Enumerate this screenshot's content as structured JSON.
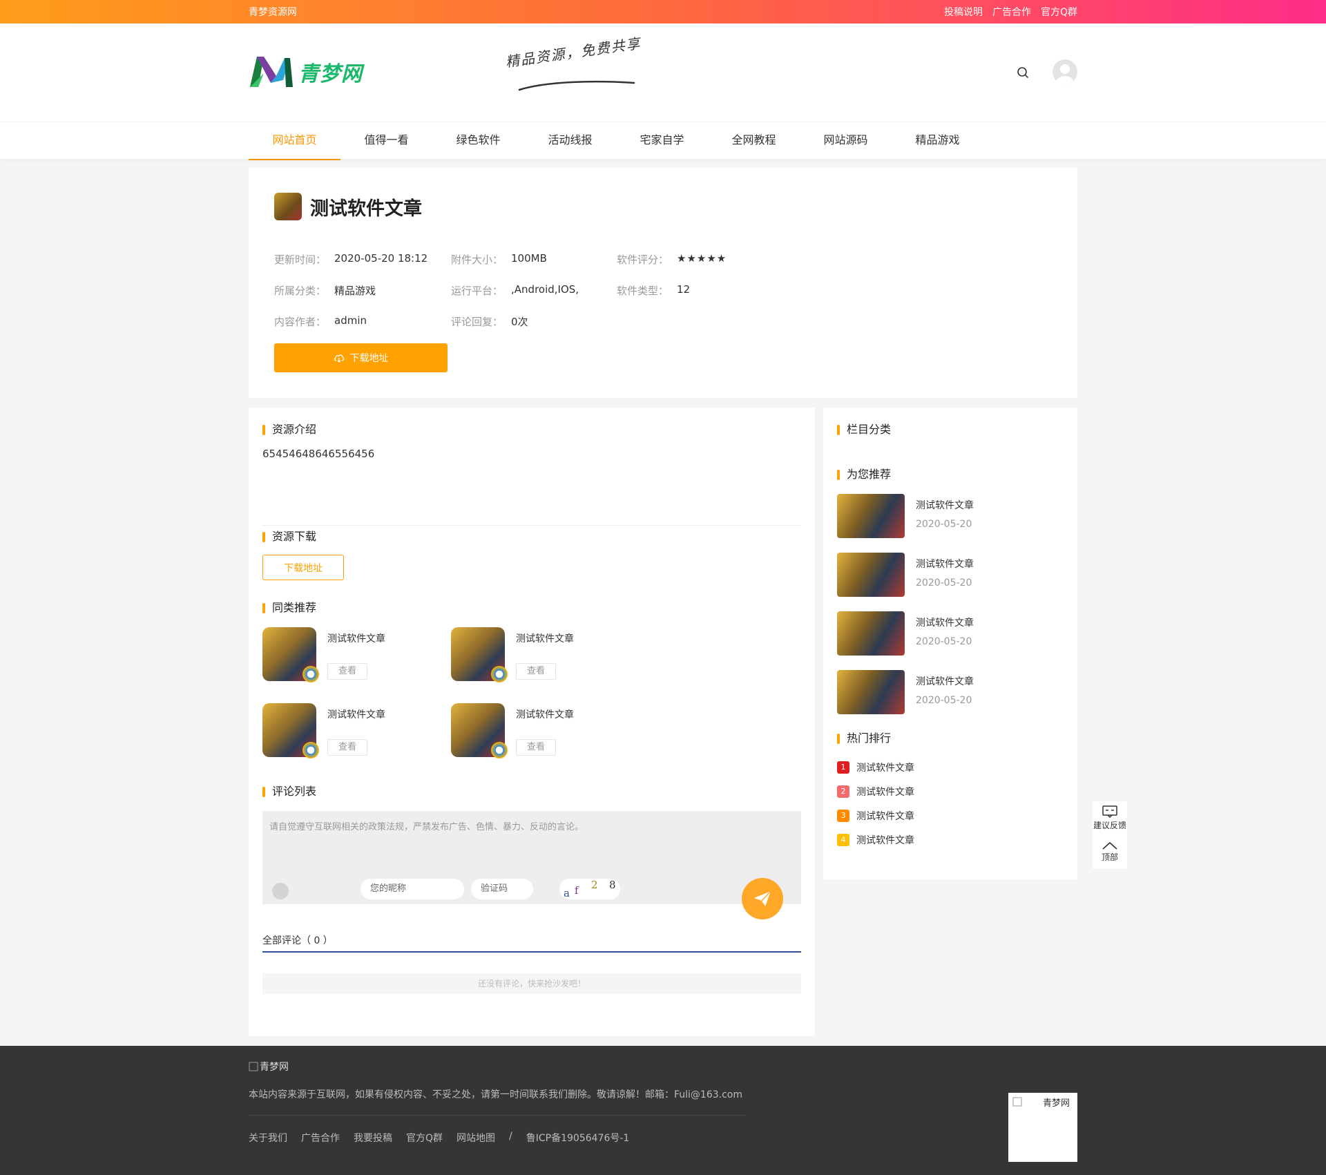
{
  "topbar": {
    "site_name": "青梦资源网",
    "links": [
      "投稿说明",
      "广告合作",
      "官方Q群"
    ]
  },
  "header": {
    "logo_text": "青梦网",
    "slogan": "精品资源，免费共享"
  },
  "nav": [
    "网站首页",
    "值得一看",
    "绿色软件",
    "活动线报",
    "宅家自学",
    "全网教程",
    "网站源码",
    "精品游戏"
  ],
  "article": {
    "title": "测试软件文章",
    "meta": [
      [
        {
          "k": "更新时间：",
          "v": "2020-05-20 18:12"
        },
        {
          "k": "附件大小：",
          "v": "100MB"
        },
        {
          "k": "软件评分：",
          "v": "★★★★★"
        }
      ],
      [
        {
          "k": "所属分类：",
          "v": "精品游戏"
        },
        {
          "k": "运行平台：",
          "v": ",Android,IOS,"
        },
        {
          "k": "软件类型：",
          "v": "12"
        }
      ],
      [
        {
          "k": "内容作者：",
          "v": "admin"
        },
        {
          "k": "评论回复：",
          "v": "0次"
        }
      ]
    ],
    "download_button": "下载地址"
  },
  "intro": {
    "title": "资源介绍",
    "text": "65454648646556456"
  },
  "download_section": {
    "title": "资源下载",
    "button": "下载地址"
  },
  "similar": {
    "title": "同类推荐",
    "items": [
      {
        "title": "测试软件文章",
        "button": "查看"
      },
      {
        "title": "测试软件文章",
        "button": "查看"
      },
      {
        "title": "测试软件文章",
        "button": "查看"
      },
      {
        "title": "测试软件文章",
        "button": "查看"
      }
    ]
  },
  "comments": {
    "title": "评论列表",
    "placeholder": "请自觉遵守互联网相关的政策法规，严禁发布广告、色情、暴力、反动的言论。",
    "nickname_placeholder": "您的昵称",
    "code_placeholder": "验证码",
    "captcha_chars": [
      "a",
      "f",
      "2",
      "8"
    ],
    "all_label": "全部评论（ 0 ）",
    "empty_text": "还没有评论，快来抢沙发吧！"
  },
  "sidebar": {
    "category_title": "栏目分类",
    "recommend_title": "为您推荐",
    "recommend": [
      {
        "title": "测试软件文章",
        "date": "2020-05-20"
      },
      {
        "title": "测试软件文章",
        "date": "2020-05-20"
      },
      {
        "title": "测试软件文章",
        "date": "2020-05-20"
      },
      {
        "title": "测试软件文章",
        "date": "2020-05-20"
      }
    ],
    "hot_title": "热门排行",
    "hot": [
      {
        "rank": "1",
        "title": "测试软件文章",
        "color": "#e02020"
      },
      {
        "rank": "2",
        "title": "测试软件文章",
        "color": "#f46b6b"
      },
      {
        "rank": "3",
        "title": "测试软件文章",
        "color": "#ff8c00"
      },
      {
        "rank": "4",
        "title": "测试软件文章",
        "color": "#ffc107"
      }
    ]
  },
  "float_widget": {
    "feedback": "建议反馈",
    "top": "顶部"
  },
  "footer": {
    "logo_alt": "青梦网",
    "note": "本站内容来源于互联网，如果有侵权内容、不妥之处，请第一时间联系我们删除。敬请谅解！邮箱：Fuli@163.com",
    "links": [
      "关于我们",
      "广告合作",
      "我要投稿",
      "官方Q群",
      "网站地图",
      "/",
      "鲁ICP备19056476号-1"
    ],
    "qr_alt": "青梦网"
  },
  "colors": {
    "accent": "#ffa100",
    "nav_active": "#ff9500"
  }
}
